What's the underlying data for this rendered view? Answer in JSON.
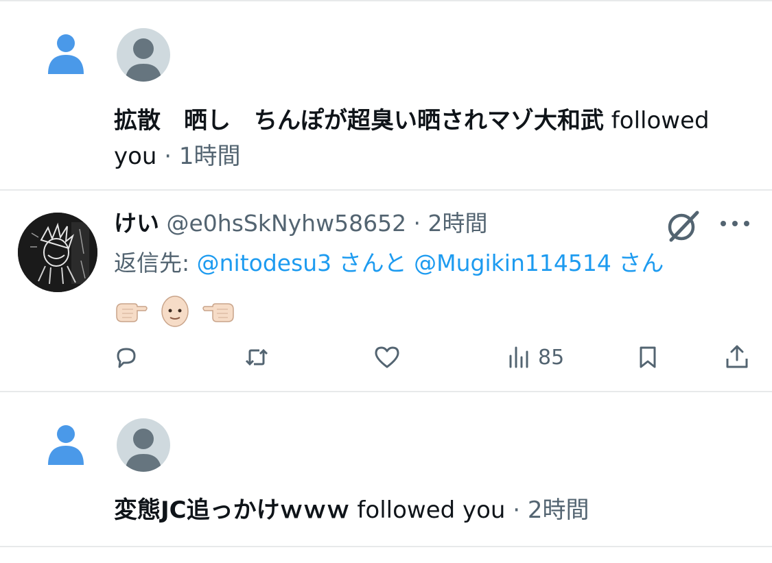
{
  "notifications": [
    {
      "name": "拡散　晒し　ちんぽが超臭い晒されマゾ大和武",
      "action_text": " followed you",
      "separator": " · ",
      "time": "1時間"
    },
    {
      "name": "変態JC追っかけｗｗｗ",
      "action_text": " followed you",
      "separator": " · ",
      "time": "2時間"
    }
  ],
  "tweet": {
    "display_name": "けい",
    "handle": "@e0hsSkNyhw58652",
    "separator": " · ",
    "time": "2時間",
    "reply_prefix": "返信先: ",
    "reply_user_1": "@nitodesu3",
    "reply_join": " さんと ",
    "reply_user_2": "@Mugikin114514",
    "reply_suffix": " さん",
    "emojis": [
      "hand-pointing-right-emoji",
      "bald-person-emoji",
      "hand-pointing-left-emoji"
    ],
    "actions": {
      "views": "85"
    }
  },
  "colors": {
    "accent": "#1d9bf0",
    "muted": "#536471",
    "text": "#0f1419",
    "divider": "#e7e9ea",
    "follow_icon": "#4a99e9"
  }
}
